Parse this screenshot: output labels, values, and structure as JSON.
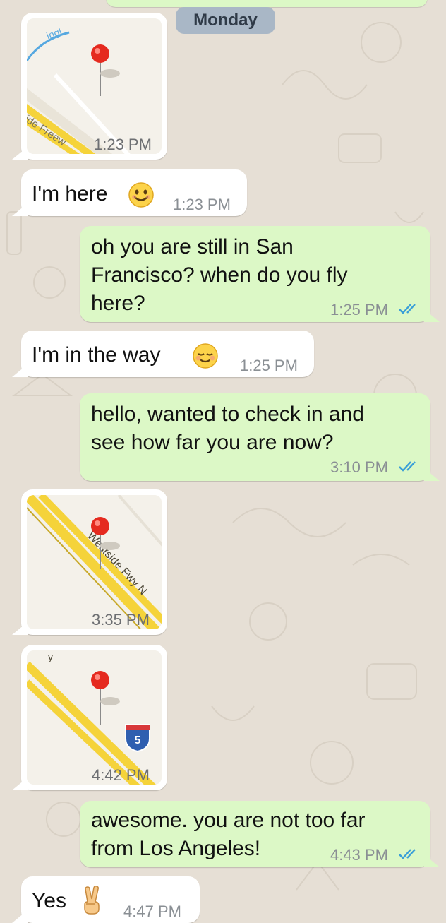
{
  "chat": {
    "date_separator": "Monday",
    "messages": [
      {
        "id": "m1",
        "direction": "incoming",
        "kind": "location",
        "map_label": "Westside Freeway",
        "map_label_visible": "ide Freew",
        "map_label_top": "ingl",
        "time": "1:23 PM"
      },
      {
        "id": "m2",
        "direction": "incoming",
        "kind": "text",
        "text": "I'm here",
        "emoji": "smiling-face-icon",
        "time": "1:23 PM"
      },
      {
        "id": "m3",
        "direction": "outgoing",
        "kind": "text",
        "text": "oh you are still in San\nFrancisco? when do you fly\nhere?",
        "time": "1:25 PM",
        "status": "read"
      },
      {
        "id": "m4",
        "direction": "incoming",
        "kind": "text",
        "text": "I'm in the way",
        "emoji": "relieved-face-icon",
        "time": "1:25 PM"
      },
      {
        "id": "m5",
        "direction": "outgoing",
        "kind": "text",
        "text": "hello, wanted to check in and\nsee how far you are now?",
        "time": "3:10 PM",
        "status": "read"
      },
      {
        "id": "m6",
        "direction": "incoming",
        "kind": "location",
        "map_label": "Westside Fwy N",
        "time": "3:35 PM"
      },
      {
        "id": "m7",
        "direction": "incoming",
        "kind": "location",
        "map_label": "y",
        "shield": "5",
        "time": "4:42 PM"
      },
      {
        "id": "m8",
        "direction": "outgoing",
        "kind": "text",
        "text": "awesome. you are not too far\nfrom Los Angeles!",
        "time": "4:43 PM",
        "status": "read"
      },
      {
        "id": "m9",
        "direction": "incoming",
        "kind": "text",
        "text": "Yes",
        "emoji": "victory-hand-icon",
        "time": "4:47 PM"
      }
    ]
  },
  "colors": {
    "background": "#e6dfd5",
    "incoming_bubble": "#ffffff",
    "outgoing_bubble": "#dcf8c6",
    "read_ticks": "#3a9fd8",
    "date_pill": "#a9b7c6",
    "map_road": "#f5d33a",
    "map_pin": "#e52a1f"
  }
}
